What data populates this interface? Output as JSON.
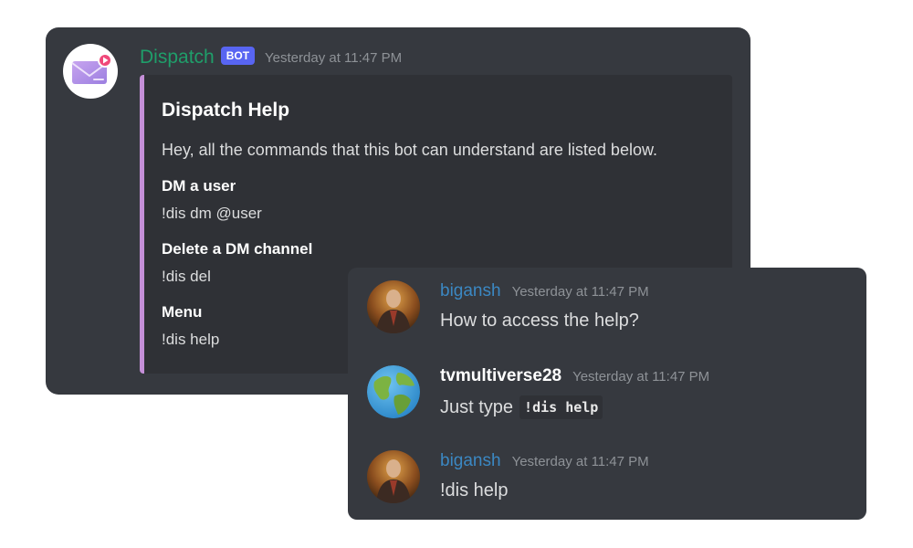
{
  "bot_message": {
    "author": "Dispatch",
    "badge": "BOT",
    "timestamp": "Yesterday at 11:47 PM",
    "avatar_icon": "envelope-icon",
    "embed": {
      "accent_color": "#c58fd8",
      "title": "Dispatch Help",
      "description": "Hey, all the commands that this bot can understand are listed below.",
      "fields": [
        {
          "name": "DM a user",
          "value": "!dis dm @user"
        },
        {
          "name": "Delete a DM channel",
          "value": "!dis del"
        },
        {
          "name": "Menu",
          "value": "!dis help"
        }
      ]
    }
  },
  "chat": {
    "messages": [
      {
        "author": "bigansh",
        "timestamp": "Yesterday at 11:47 PM",
        "text": "How to access the help?",
        "avatar_icon": "user-avatar"
      },
      {
        "author": "tvmultiverse28",
        "timestamp": "Yesterday at 11:47 PM",
        "text": "Just type",
        "code": "!dis help",
        "avatar_icon": "globe-icon"
      },
      {
        "author": "bigansh",
        "timestamp": "Yesterday at 11:47 PM",
        "text": "!dis help",
        "avatar_icon": "user-avatar"
      }
    ]
  },
  "colors": {
    "background": "#36393f",
    "embed_background": "#2f3136",
    "bot_name": "#1f9e6a",
    "badge": "#5865f2",
    "user_name_blue": "#3b88c3",
    "timestamp": "#8e9297"
  }
}
